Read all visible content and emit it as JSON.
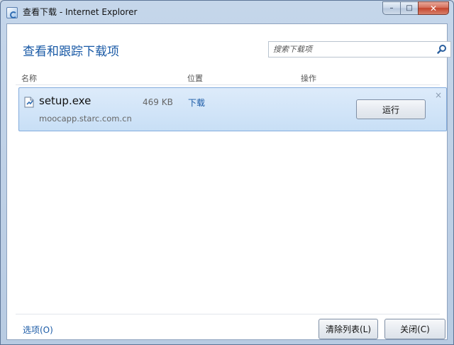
{
  "window": {
    "title": "查看下载 - Internet Explorer",
    "controls": {
      "minimize": "–",
      "maximize": "□",
      "close": "✕"
    }
  },
  "header": {
    "title": "查看和跟踪下载项",
    "search_placeholder": "搜索下载项"
  },
  "columns": {
    "name": "名称",
    "location": "位置",
    "actions": "操作"
  },
  "downloads": [
    {
      "file_name": "setup.exe",
      "size": "469 KB",
      "source": "moocapp.starc.com.cn",
      "location": "下载",
      "action_label": "运行",
      "dismiss": "×"
    }
  ],
  "footer": {
    "options_label": "选项(O)",
    "clear_list_label": "清除列表(L)",
    "close_label": "关闭(C)"
  },
  "colors": {
    "accent": "#1a5aa6",
    "row_selected": "#c8dff6"
  }
}
